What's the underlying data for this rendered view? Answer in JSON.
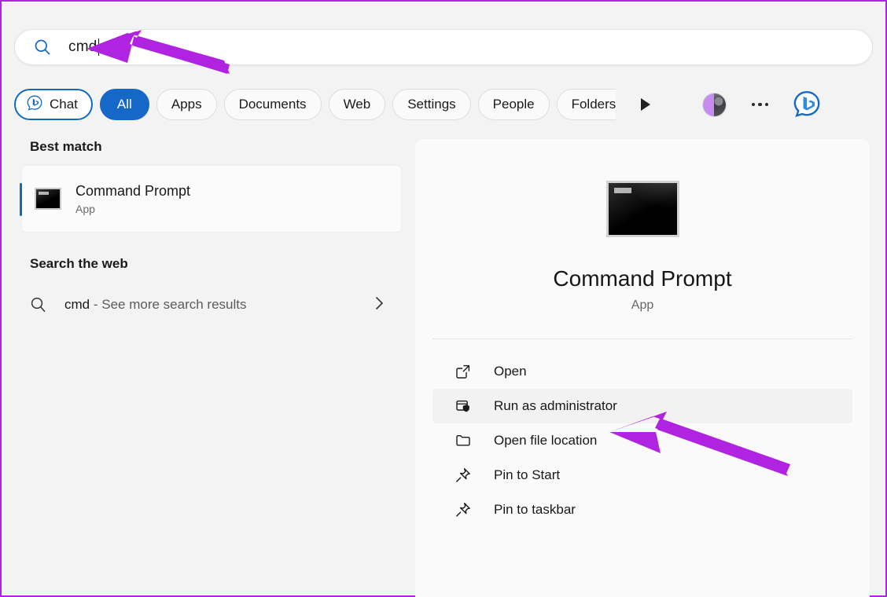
{
  "search": {
    "query": "cmd",
    "icon": "search-icon"
  },
  "filters": {
    "chat": {
      "label": "Chat",
      "icon": "bing-chat-icon"
    },
    "tabs": [
      {
        "label": "All",
        "active": true
      },
      {
        "label": "Apps",
        "active": false
      },
      {
        "label": "Documents",
        "active": false
      },
      {
        "label": "Web",
        "active": false
      },
      {
        "label": "Settings",
        "active": false
      },
      {
        "label": "People",
        "active": false
      },
      {
        "label": "Folders",
        "active": false
      }
    ],
    "more_icon": "play-arrow-icon",
    "avatar_icon": "user-avatar",
    "overflow_icon": "ellipsis-icon",
    "bing_icon": "bing-icon"
  },
  "results": {
    "best_match_heading": "Best match",
    "best_match": {
      "title": "Command Prompt",
      "subtitle": "App",
      "icon": "command-prompt-icon"
    },
    "web_heading": "Search the web",
    "web_item": {
      "query": "cmd",
      "suffix": " - See more search results",
      "icon": "search-icon",
      "chevron": "chevron-right-icon"
    }
  },
  "preview": {
    "app_icon": "command-prompt-icon",
    "title": "Command Prompt",
    "subtitle": "App",
    "actions": [
      {
        "label": "Open",
        "icon": "open-external-icon",
        "highlighted": false
      },
      {
        "label": "Run as administrator",
        "icon": "shield-window-icon",
        "highlighted": true
      },
      {
        "label": "Open file location",
        "icon": "folder-icon",
        "highlighted": false
      },
      {
        "label": "Pin to Start",
        "icon": "pin-icon",
        "highlighted": false
      },
      {
        "label": "Pin to taskbar",
        "icon": "pin-icon",
        "highlighted": false
      }
    ]
  },
  "colors": {
    "accent_blue": "#1668c8",
    "chat_border": "#0f6cbd",
    "annotation_purple": "#b023e0",
    "border_purple": "#b023e0"
  }
}
